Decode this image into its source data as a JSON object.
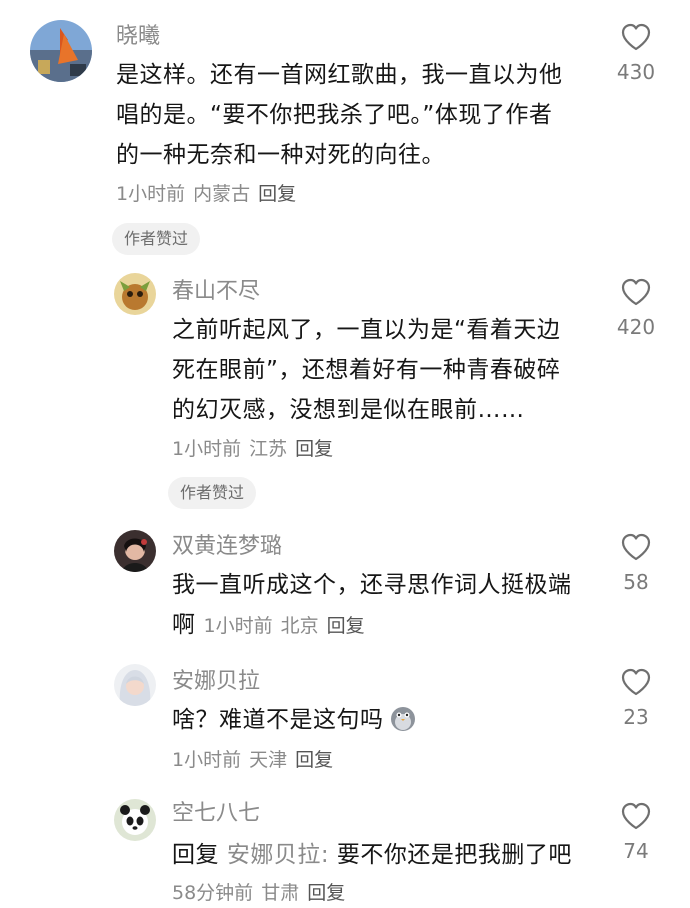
{
  "comments": [
    {
      "author": "晓曦",
      "lines": [
        "是这样。还有一首网红歌曲，我一直以为他",
        "唱的是。“要不你把我杀了吧。”体现了作者",
        "的一种无奈和一种对死的向往。"
      ],
      "time": "1小时前",
      "location": "内蒙古",
      "reply": "回复",
      "badge": "作者赞过",
      "likes": "430",
      "avatar_icon": "landscape-avatar-icon"
    },
    {
      "author": "春山不尽",
      "lines": [
        "之前听起风了，一直以为是“看着天边",
        "死在眼前”，还想着好有一种青春破碎",
        "的幻灭感，没想到是似在眼前……"
      ],
      "time": "1小时前",
      "location": "江苏",
      "reply": "回复",
      "badge": "作者赞过",
      "likes": "420",
      "avatar_icon": "cartoon-avatar-icon"
    },
    {
      "author": "双黄连梦璐",
      "lines": [
        "我一直听成这个，还寻思作词人挺极端",
        "啊"
      ],
      "time": "1小时前",
      "location": "北京",
      "reply": "回复",
      "likes": "58",
      "avatar_icon": "portrait-avatar-icon"
    },
    {
      "author": "安娜贝拉",
      "lines": [
        "啥？难道不是这句吗"
      ],
      "emoji": "penguin-emoji-icon",
      "time": "1小时前",
      "location": "天津",
      "reply": "回复",
      "likes": "23",
      "avatar_icon": "anime-avatar-icon"
    },
    {
      "author": "空七八七",
      "reply_prefix": "回复",
      "reply_target": "安娜贝拉:",
      "reply_text": "要不你还是把我删了吧",
      "time": "58分钟前",
      "location": "甘肃",
      "reply": "回复",
      "likes": "74",
      "avatar_icon": "panda-avatar-icon"
    }
  ]
}
